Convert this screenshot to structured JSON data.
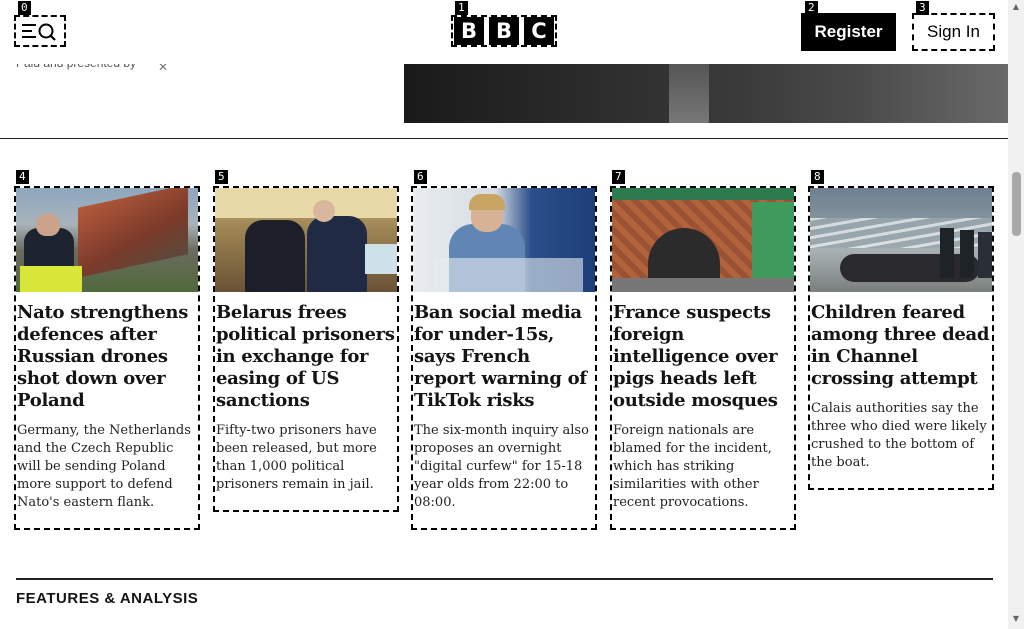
{
  "markers": [
    "0",
    "1",
    "2",
    "3",
    "4",
    "5",
    "6",
    "7",
    "8"
  ],
  "header": {
    "logo_letters": [
      "B",
      "B",
      "C"
    ],
    "register_label": "Register",
    "signin_label": "Sign In",
    "menu_icon": "menu-search-icon"
  },
  "promo": {
    "text": "Paid and presented by"
  },
  "cards": [
    {
      "headline": "Nato strengthens defences after Russian drones shot down over Poland",
      "summary": "Germany, the Netherlands and the Czech Republic will be sending Poland more support to defend Nato's eastern flank."
    },
    {
      "headline": "Belarus frees political prisoners in exchange for easing of US sanctions",
      "summary": "Fifty-two prisoners have been released, but more than 1,000 political prisoners remain in jail."
    },
    {
      "headline": "Ban social media for under-15s, says French report warning of TikTok risks",
      "summary": "The six-month inquiry also proposes an overnight \"digital curfew\" for 15-18 year olds from 22:00 to 08:00."
    },
    {
      "headline": "France suspects foreign intelligence over pigs heads left outside mosques",
      "summary": "Foreign nationals are blamed for the incident, which has striking similarities with other recent provocations."
    },
    {
      "headline": "Children feared among three dead in Channel crossing attempt",
      "summary": "Calais authorities say the three who died were likely crushed to the bottom of the boat."
    }
  ],
  "features": {
    "title": "FEATURES & ANALYSIS"
  }
}
